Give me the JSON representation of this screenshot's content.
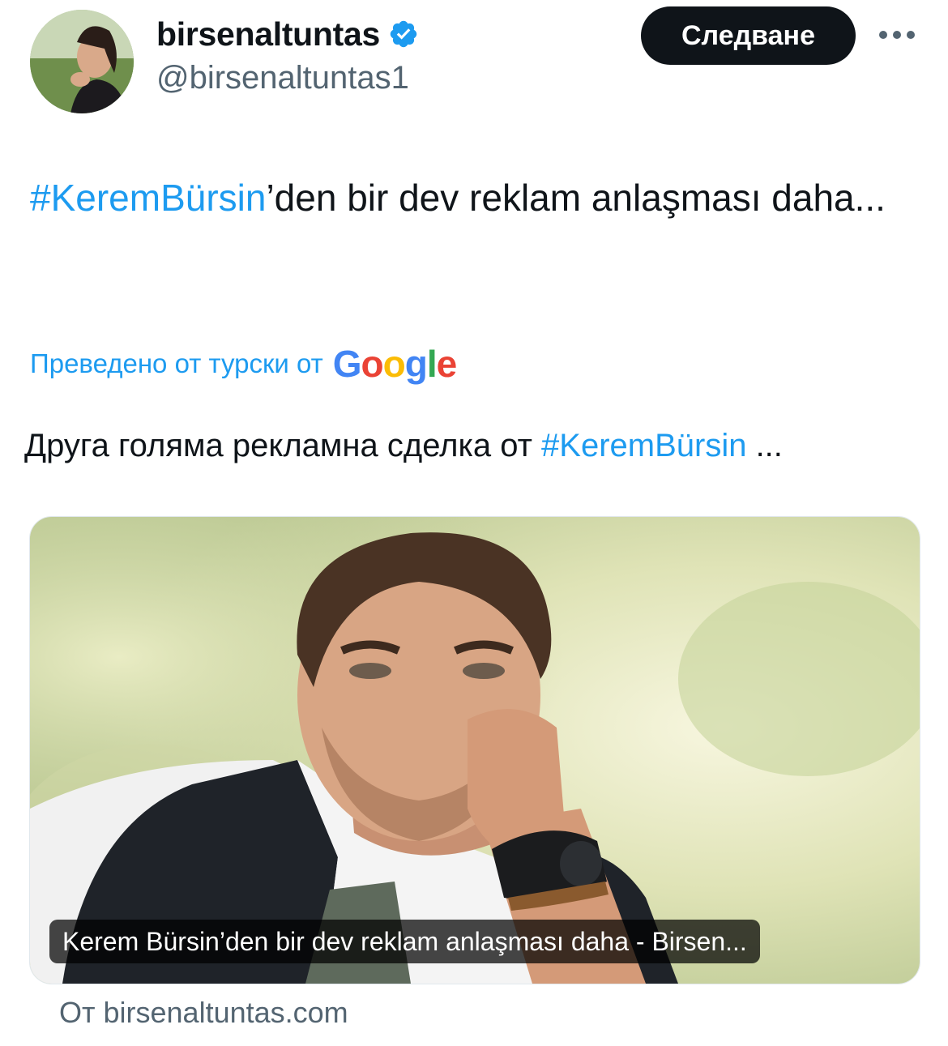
{
  "author": {
    "display_name": "birsenaltuntas",
    "handle": "@birsenaltuntas1",
    "verified": true,
    "avatar_icon": "avatar-photo"
  },
  "follow_button": {
    "label": "Следване"
  },
  "more_button": {
    "icon": "more-horizontal-icon"
  },
  "tweet": {
    "hashtag": "#KeremBürsin",
    "text_after_hashtag": "’den bir dev reklam anlaşması daha..."
  },
  "translation": {
    "label": "Преведено от турски от",
    "provider": "Google",
    "text_before_hashtag": "Друга голяма рекламна сделка от ",
    "hashtag": "#KeremBürsin",
    "text_after_hashtag": " ..."
  },
  "link_card": {
    "caption": "Kerem Bürsin’den bir dev reklam anlaşması daha - Birsen...",
    "source": "От birsenaltuntas.com"
  },
  "colors": {
    "link_blue": "#1d9bf0",
    "text_primary": "#0f1419",
    "text_secondary": "#536471",
    "button_bg": "#0f1419"
  }
}
